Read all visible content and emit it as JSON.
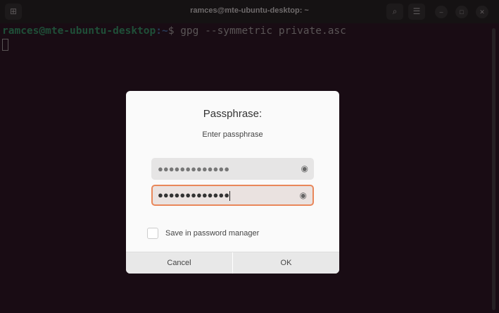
{
  "window": {
    "title": "ramces@mte-ubuntu-desktop: ~"
  },
  "terminal": {
    "user_host": "ramces@mte-ubuntu-desktop",
    "path": ":~",
    "prompt": "$ ",
    "command": "gpg --symmetric private.asc"
  },
  "dialog": {
    "title": "Passphrase:",
    "subtitle": "Enter passphrase",
    "passphrase_value": "●●●●●●●●●●●●●",
    "confirm_value": "●●●●●●●●●●●●●",
    "save_label": "Save in password manager",
    "save_checked": false,
    "cancel_label": "Cancel",
    "ok_label": "OK"
  },
  "colors": {
    "accent": "#e9875a",
    "background": "#190c14"
  }
}
